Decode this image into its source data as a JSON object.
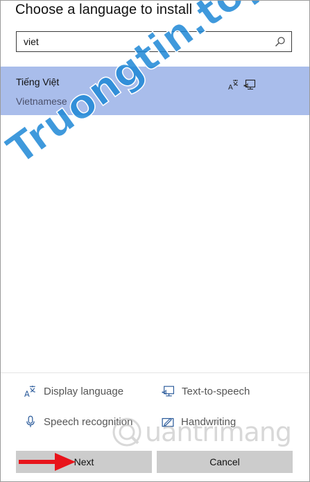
{
  "dialog": {
    "title": "Choose a language to install"
  },
  "search": {
    "value": "viet",
    "placeholder": ""
  },
  "languages": [
    {
      "name": "Tiếng Việt",
      "english_name": "Vietnamese",
      "selected": true,
      "features": [
        "display-language-icon",
        "text-to-speech-icon"
      ]
    }
  ],
  "legend": [
    {
      "icon": "display-language-icon",
      "label": "Display language"
    },
    {
      "icon": "text-to-speech-icon",
      "label": "Text-to-speech"
    },
    {
      "icon": "speech-recognition-icon",
      "label": "Speech recognition"
    },
    {
      "icon": "handwriting-icon",
      "label": "Handwriting"
    }
  ],
  "buttons": {
    "next_label": "Next",
    "cancel_label": "Cancel"
  },
  "watermarks": {
    "primary": "Truongtin.top",
    "secondary": "uantrimang"
  },
  "colors": {
    "selection": "#a9bdeb",
    "button": "#cccccc",
    "arrow": "#e8141b",
    "watermark_primary": "#1d87d6",
    "watermark_accent": "#e0262b"
  }
}
